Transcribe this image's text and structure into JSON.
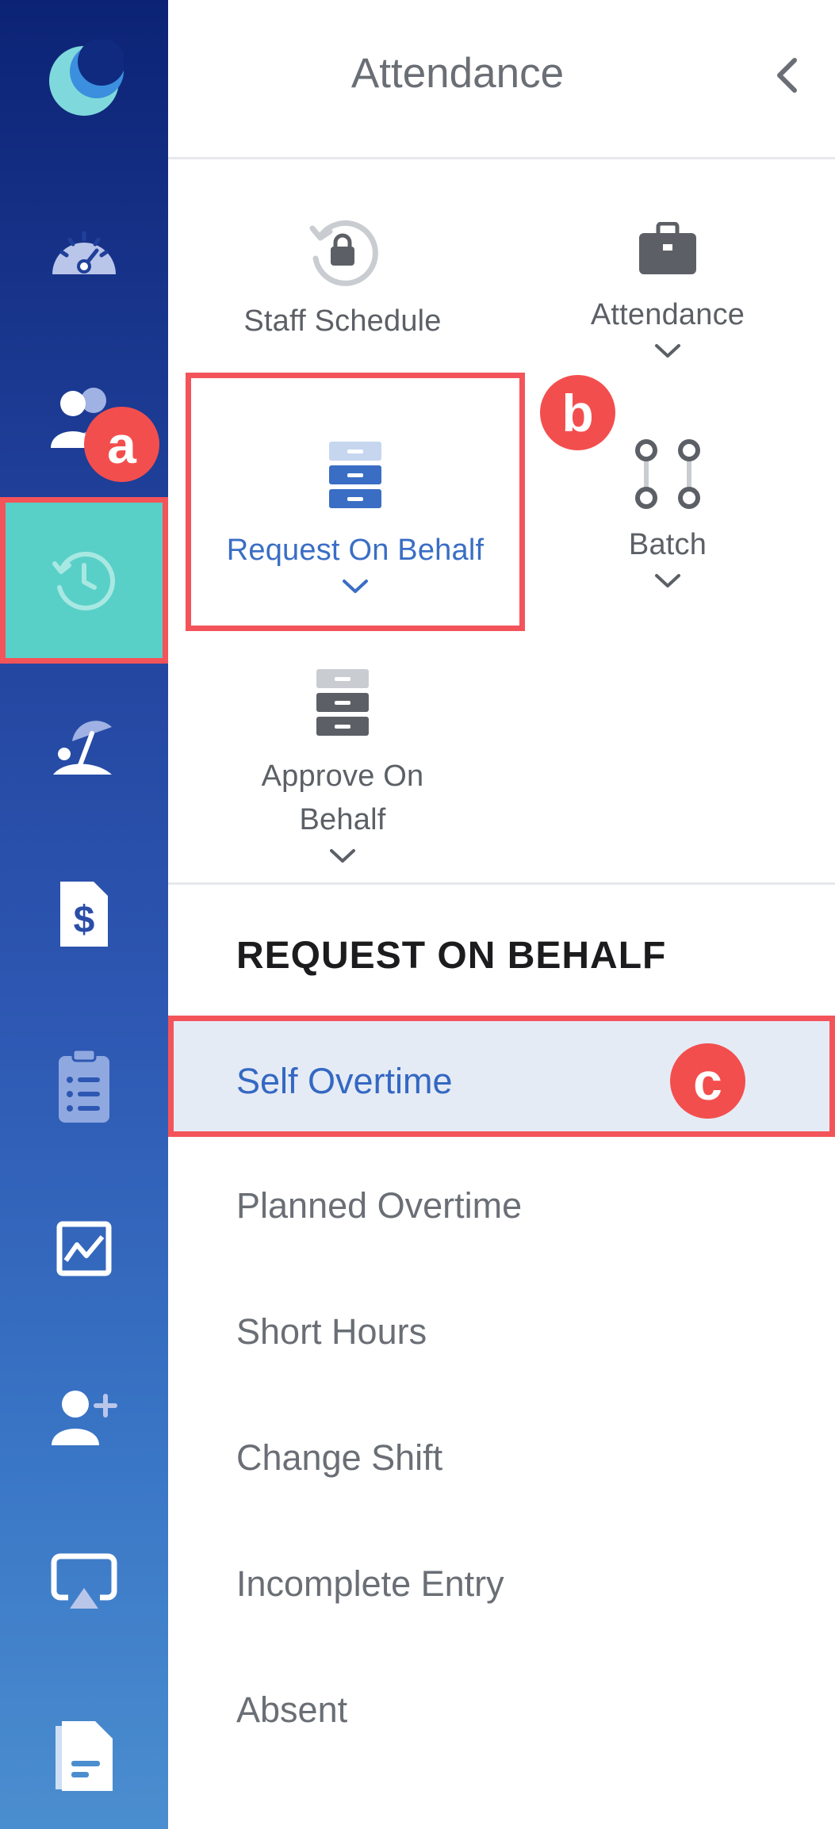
{
  "colors": {
    "sidebar_top": "#0c2375",
    "sidebar_bottom": "#4b8ecf",
    "active_nav": "#59d0c7",
    "annotation_red": "#f34e4e",
    "active_text": "#3468c2",
    "text_gray": "#6a6e75"
  },
  "sidebar": {
    "items": [
      {
        "icon": "moon-logo-icon"
      },
      {
        "icon": "dashboard-gauge-icon"
      },
      {
        "icon": "people-icon"
      },
      {
        "icon": "attendance-clock-history-icon",
        "active": true
      },
      {
        "icon": "beach-umbrella-icon"
      },
      {
        "icon": "payroll-dollar-icon"
      },
      {
        "icon": "clipboard-list-icon"
      },
      {
        "icon": "chart-icon"
      },
      {
        "icon": "add-user-icon"
      },
      {
        "icon": "airplay-screen-icon"
      },
      {
        "icon": "document-icon"
      }
    ]
  },
  "annotations": {
    "a": "a",
    "b": "b",
    "c": "c"
  },
  "header": {
    "title": "Attendance"
  },
  "tiles": {
    "staff_schedule": {
      "label": "Staff Schedule",
      "icon": "lock-history-icon"
    },
    "attendance": {
      "label": "Attendance",
      "icon": "briefcase-icon"
    },
    "request_on_behalf": {
      "label": "Request On Behalf",
      "icon": "cabinet-icon",
      "active": true
    },
    "batch": {
      "label": "Batch",
      "icon": "batch-nodes-icon"
    },
    "approve_on_behalf": {
      "label_line1": "Approve On",
      "label_line2": "Behalf",
      "icon": "cabinet-icon"
    }
  },
  "submenu": {
    "title": "REQUEST ON BEHALF",
    "items": [
      {
        "label": "Self Overtime",
        "active": true
      },
      {
        "label": "Planned Overtime"
      },
      {
        "label": "Short Hours"
      },
      {
        "label": "Change Shift"
      },
      {
        "label": "Incomplete Entry"
      },
      {
        "label": "Absent"
      }
    ]
  }
}
